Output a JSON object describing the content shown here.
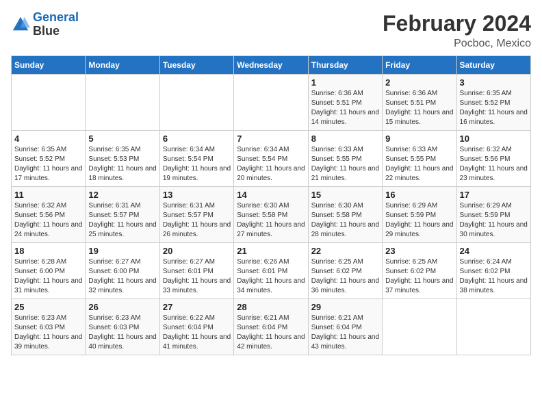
{
  "header": {
    "logo_line1": "General",
    "logo_line2": "Blue",
    "title": "February 2024",
    "subtitle": "Pocboc, Mexico"
  },
  "weekdays": [
    "Sunday",
    "Monday",
    "Tuesday",
    "Wednesday",
    "Thursday",
    "Friday",
    "Saturday"
  ],
  "weeks": [
    [
      {
        "day": "",
        "info": ""
      },
      {
        "day": "",
        "info": ""
      },
      {
        "day": "",
        "info": ""
      },
      {
        "day": "",
        "info": ""
      },
      {
        "day": "1",
        "info": "Sunrise: 6:36 AM\nSunset: 5:51 PM\nDaylight: 11 hours and 14 minutes."
      },
      {
        "day": "2",
        "info": "Sunrise: 6:36 AM\nSunset: 5:51 PM\nDaylight: 11 hours and 15 minutes."
      },
      {
        "day": "3",
        "info": "Sunrise: 6:35 AM\nSunset: 5:52 PM\nDaylight: 11 hours and 16 minutes."
      }
    ],
    [
      {
        "day": "4",
        "info": "Sunrise: 6:35 AM\nSunset: 5:52 PM\nDaylight: 11 hours and 17 minutes."
      },
      {
        "day": "5",
        "info": "Sunrise: 6:35 AM\nSunset: 5:53 PM\nDaylight: 11 hours and 18 minutes."
      },
      {
        "day": "6",
        "info": "Sunrise: 6:34 AM\nSunset: 5:54 PM\nDaylight: 11 hours and 19 minutes."
      },
      {
        "day": "7",
        "info": "Sunrise: 6:34 AM\nSunset: 5:54 PM\nDaylight: 11 hours and 20 minutes."
      },
      {
        "day": "8",
        "info": "Sunrise: 6:33 AM\nSunset: 5:55 PM\nDaylight: 11 hours and 21 minutes."
      },
      {
        "day": "9",
        "info": "Sunrise: 6:33 AM\nSunset: 5:55 PM\nDaylight: 11 hours and 22 minutes."
      },
      {
        "day": "10",
        "info": "Sunrise: 6:32 AM\nSunset: 5:56 PM\nDaylight: 11 hours and 23 minutes."
      }
    ],
    [
      {
        "day": "11",
        "info": "Sunrise: 6:32 AM\nSunset: 5:56 PM\nDaylight: 11 hours and 24 minutes."
      },
      {
        "day": "12",
        "info": "Sunrise: 6:31 AM\nSunset: 5:57 PM\nDaylight: 11 hours and 25 minutes."
      },
      {
        "day": "13",
        "info": "Sunrise: 6:31 AM\nSunset: 5:57 PM\nDaylight: 11 hours and 26 minutes."
      },
      {
        "day": "14",
        "info": "Sunrise: 6:30 AM\nSunset: 5:58 PM\nDaylight: 11 hours and 27 minutes."
      },
      {
        "day": "15",
        "info": "Sunrise: 6:30 AM\nSunset: 5:58 PM\nDaylight: 11 hours and 28 minutes."
      },
      {
        "day": "16",
        "info": "Sunrise: 6:29 AM\nSunset: 5:59 PM\nDaylight: 11 hours and 29 minutes."
      },
      {
        "day": "17",
        "info": "Sunrise: 6:29 AM\nSunset: 5:59 PM\nDaylight: 11 hours and 30 minutes."
      }
    ],
    [
      {
        "day": "18",
        "info": "Sunrise: 6:28 AM\nSunset: 6:00 PM\nDaylight: 11 hours and 31 minutes."
      },
      {
        "day": "19",
        "info": "Sunrise: 6:27 AM\nSunset: 6:00 PM\nDaylight: 11 hours and 32 minutes."
      },
      {
        "day": "20",
        "info": "Sunrise: 6:27 AM\nSunset: 6:01 PM\nDaylight: 11 hours and 33 minutes."
      },
      {
        "day": "21",
        "info": "Sunrise: 6:26 AM\nSunset: 6:01 PM\nDaylight: 11 hours and 34 minutes."
      },
      {
        "day": "22",
        "info": "Sunrise: 6:25 AM\nSunset: 6:02 PM\nDaylight: 11 hours and 36 minutes."
      },
      {
        "day": "23",
        "info": "Sunrise: 6:25 AM\nSunset: 6:02 PM\nDaylight: 11 hours and 37 minutes."
      },
      {
        "day": "24",
        "info": "Sunrise: 6:24 AM\nSunset: 6:02 PM\nDaylight: 11 hours and 38 minutes."
      }
    ],
    [
      {
        "day": "25",
        "info": "Sunrise: 6:23 AM\nSunset: 6:03 PM\nDaylight: 11 hours and 39 minutes."
      },
      {
        "day": "26",
        "info": "Sunrise: 6:23 AM\nSunset: 6:03 PM\nDaylight: 11 hours and 40 minutes."
      },
      {
        "day": "27",
        "info": "Sunrise: 6:22 AM\nSunset: 6:04 PM\nDaylight: 11 hours and 41 minutes."
      },
      {
        "day": "28",
        "info": "Sunrise: 6:21 AM\nSunset: 6:04 PM\nDaylight: 11 hours and 42 minutes."
      },
      {
        "day": "29",
        "info": "Sunrise: 6:21 AM\nSunset: 6:04 PM\nDaylight: 11 hours and 43 minutes."
      },
      {
        "day": "",
        "info": ""
      },
      {
        "day": "",
        "info": ""
      }
    ]
  ]
}
